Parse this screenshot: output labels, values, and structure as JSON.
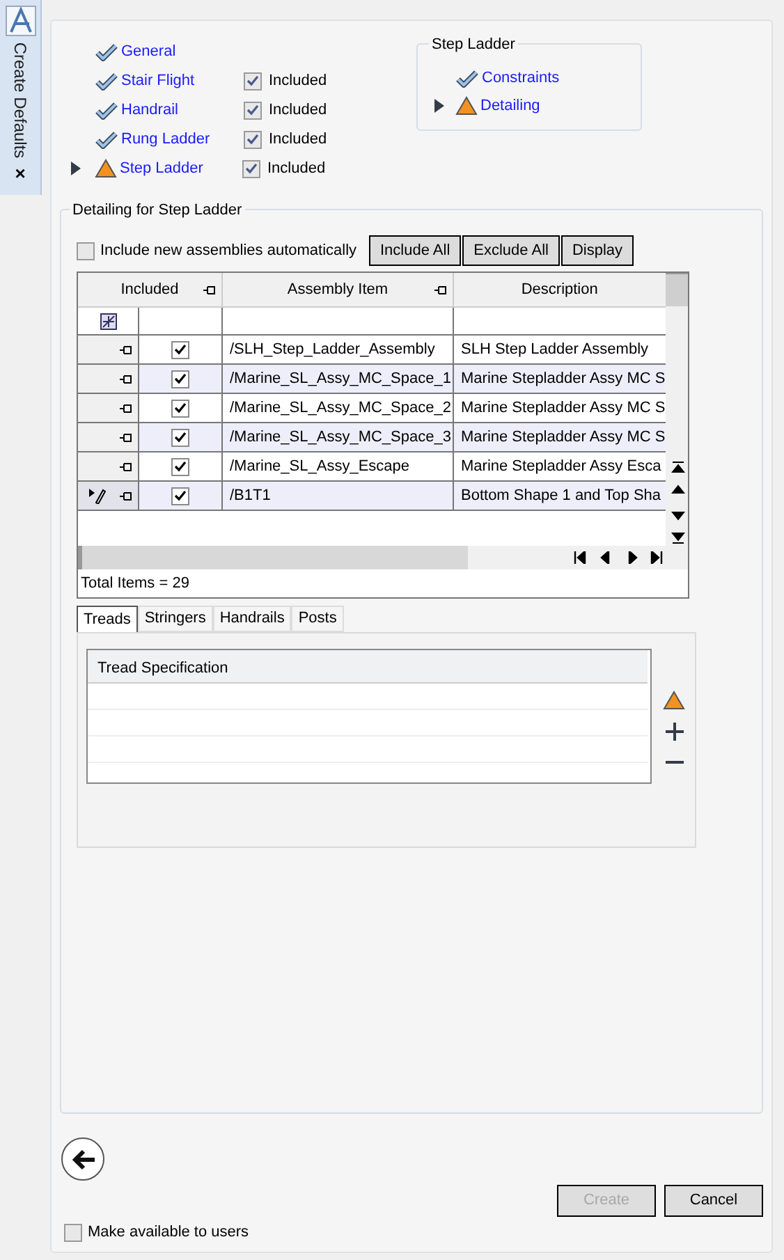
{
  "sidebar": {
    "title": "Create Defaults",
    "close": "×"
  },
  "nav": [
    {
      "label": "General",
      "kind": "complete",
      "current": false
    },
    {
      "label": "Stair Flight",
      "kind": "complete",
      "current": false,
      "included": {
        "label": "Included",
        "checked": true
      }
    },
    {
      "label": "Handrail",
      "kind": "complete",
      "current": false,
      "included": {
        "label": "Included",
        "checked": true
      }
    },
    {
      "label": "Rung Ladder",
      "kind": "complete",
      "current": false,
      "included": {
        "label": "Included",
        "checked": true
      }
    },
    {
      "label": "Step Ladder",
      "kind": "warning",
      "current": true,
      "included": {
        "label": "Included",
        "checked": true
      }
    }
  ],
  "step_ladder": {
    "title": "Step Ladder",
    "items": [
      {
        "label": "Constraints",
        "kind": "complete",
        "current": false
      },
      {
        "label": "Detailing",
        "kind": "warning",
        "current": true
      }
    ]
  },
  "detailing": {
    "title": "Detailing for Step Ladder",
    "auto_include": {
      "label": "Include new assemblies automatically",
      "checked": false
    },
    "buttons": [
      "Include All",
      "Exclude All",
      "Display"
    ],
    "table": {
      "columns": [
        "Included",
        "Assembly Item",
        "Description"
      ],
      "rows": [
        {
          "included": true,
          "item": "/SLH_Step_Ladder_Assembly",
          "description": "SLH Step Ladder Assembly",
          "selected": false
        },
        {
          "included": true,
          "item": "/Marine_SL_Assy_MC_Space_1",
          "description": "Marine Stepladder Assy MC S",
          "selected": false
        },
        {
          "included": true,
          "item": "/Marine_SL_Assy_MC_Space_2",
          "description": "Marine Stepladder Assy MC S",
          "selected": false
        },
        {
          "included": true,
          "item": "/Marine_SL_Assy_MC_Space_3",
          "description": "Marine Stepladder Assy MC S",
          "selected": false
        },
        {
          "included": true,
          "item": "/Marine_SL_Assy_Escape",
          "description": "Marine Stepladder Assy Esca",
          "selected": false
        },
        {
          "included": true,
          "item": "/B1T1",
          "description": "Bottom Shape 1 and Top Sha",
          "selected": true
        }
      ],
      "total": "Total Items = 29"
    },
    "tabs": [
      {
        "label": "Treads",
        "selected": true
      },
      {
        "label": "Stringers",
        "selected": false
      },
      {
        "label": "Handrails",
        "selected": false
      },
      {
        "label": "Posts",
        "selected": false
      }
    ],
    "spec_table": {
      "columns": [
        "Tread Specification"
      ]
    }
  },
  "footer": {
    "create": {
      "label": "Create",
      "disabled": true
    },
    "cancel": {
      "label": "Cancel",
      "disabled": false
    },
    "make_available": {
      "label": "Make available to users",
      "checked": false
    }
  }
}
